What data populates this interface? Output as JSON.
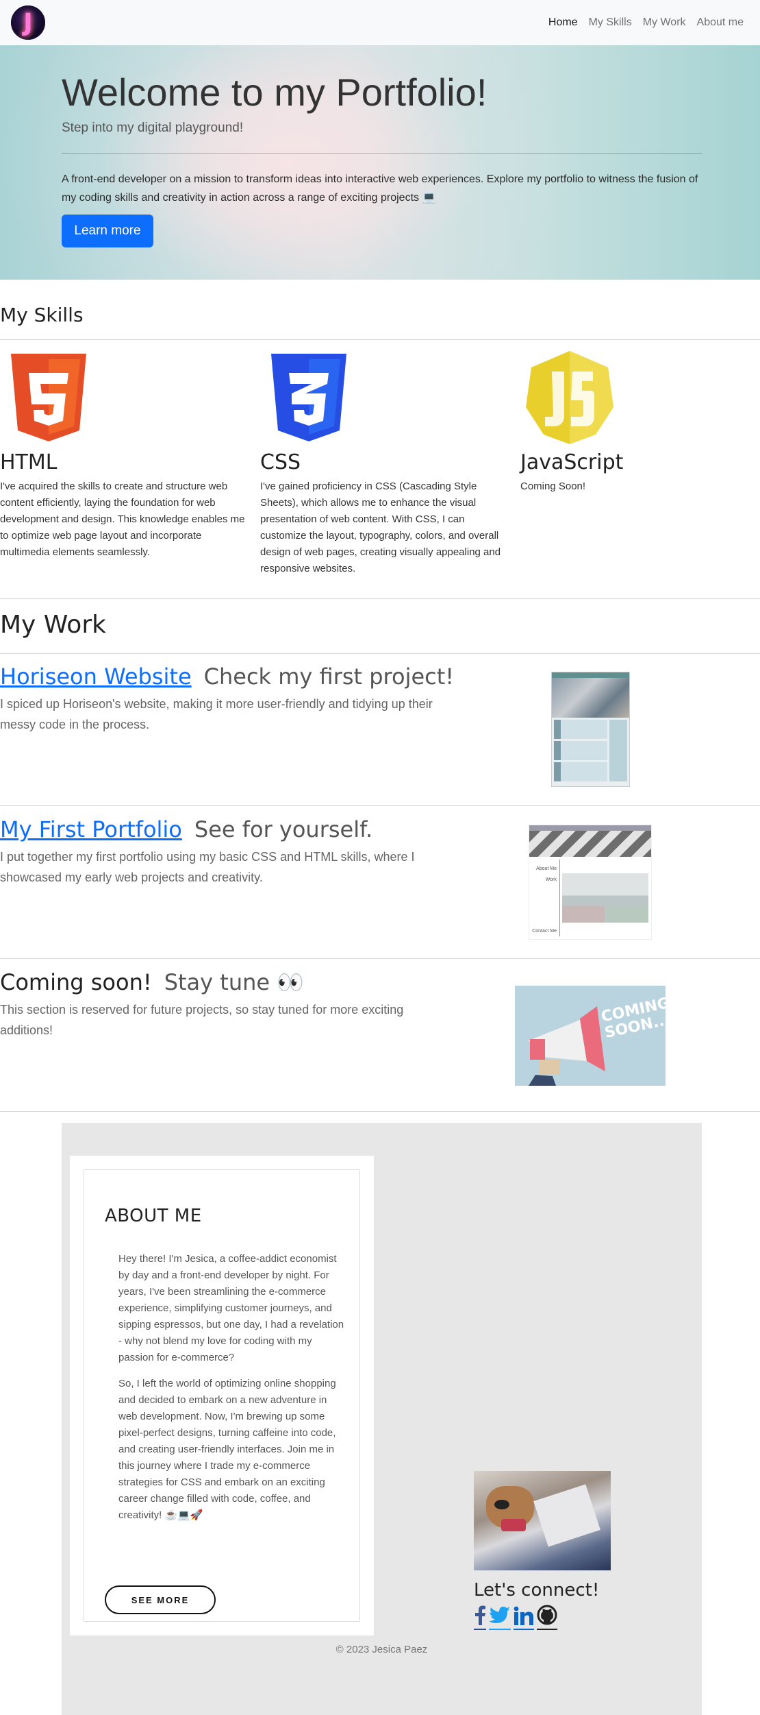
{
  "nav": {
    "logo_letter": "J",
    "links": [
      {
        "label": "Home",
        "active": true
      },
      {
        "label": "My Skills",
        "active": false
      },
      {
        "label": "My Work",
        "active": false
      },
      {
        "label": "About me",
        "active": false
      }
    ]
  },
  "hero": {
    "title": "Welcome to my Portfolio!",
    "subtitle": "Step into my digital playground!",
    "description": "A front-end developer on a mission to transform ideas into interactive web experiences. Explore my portfolio to witness the fusion of my coding skills and creativity in action across a range of exciting projects 💻",
    "button_label": "Learn more"
  },
  "skills": {
    "heading": "My Skills",
    "items": [
      {
        "name": "HTML",
        "icon": "html5-icon",
        "color": "#e44d26",
        "badge": "5",
        "text": "I've acquired the skills to create and structure web content efficiently, laying the foundation for web development and design. This knowledge enables me to optimize web page layout and incorporate multimedia elements seamlessly."
      },
      {
        "name": "CSS",
        "icon": "css3-icon",
        "color": "#264de4",
        "badge": "3",
        "text": "I've gained proficiency in CSS (Cascading Style Sheets), which allows me to enhance the visual presentation of web content. With CSS, I can customize the layout, typography, colors, and overall design of web pages, creating visually appealing and responsive websites."
      },
      {
        "name": "JavaScript",
        "icon": "js-icon",
        "color": "#f0db4f",
        "badge": "JS",
        "text": "Coming Soon!"
      }
    ]
  },
  "work": {
    "heading": "My Work",
    "items": [
      {
        "link": "Horiseon Website",
        "tagline": "Check my first project!",
        "text": "I spiced up Horiseon's website, making it more user-friendly and tidying up their messy code in the process."
      },
      {
        "link": "My First Portfolio",
        "tagline": "See for yourself.",
        "text": "I put together my first portfolio using my basic CSS and HTML skills, where I showcased my early web projects and creativity."
      },
      {
        "link": "Coming soon!",
        "tagline": "Stay tune 👀",
        "text": "This section is reserved for future projects, so stay tuned for more exciting additions!"
      }
    ],
    "portfolio_thumb_labels": [
      "About Me",
      "Work",
      "Contact Me"
    ],
    "coming_soon_graphic": [
      "COMING",
      "SOON..."
    ]
  },
  "about": {
    "heading": "ABOUT ME",
    "paragraphs": [
      "Hey there! I'm Jesica, a coffee-addict economist by day and a front-end developer by night. For years, I've been streamlining the e-commerce experience, simplifying customer journeys, and sipping espressos, but one day, I had a revelation - why not blend my love for coding with my passion for e-commerce?",
      "So, I left the world of optimizing online shopping and decided to embark on a new adventure in web development. Now, I'm brewing up some pixel-perfect designs, turning caffeine into code, and creating user-friendly interfaces. Join me in this journey where I trade my e-commerce strategies for CSS and embark on an exciting career change filled with code, coffee, and creativity! ☕💻🚀"
    ],
    "button_label": "SEE MORE",
    "connect_heading": "Let's connect!",
    "socials": [
      "facebook-icon",
      "twitter-icon",
      "linkedin-icon",
      "github-icon"
    ]
  },
  "footer": {
    "text": "© 2023 Jesica Paez"
  },
  "colors": {
    "primary": "#0d6efd",
    "navbar_bg": "#f8f9fa",
    "about_bg": "#e7e7e7"
  }
}
